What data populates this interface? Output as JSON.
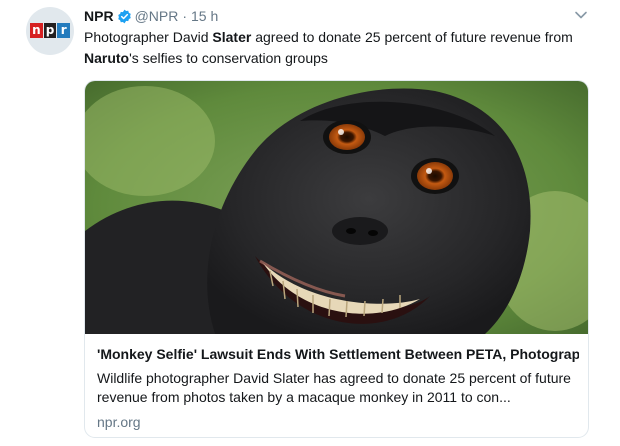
{
  "tweet": {
    "author_name": "NPR",
    "handle": "@NPR",
    "separator": "·",
    "time": "15 h",
    "logo_letters": [
      "n",
      "p",
      "r"
    ],
    "text_parts": [
      "Photographer David ",
      "Slater",
      " agreed to donate 25 percent of future revenue from ",
      "Naruto",
      "'s selfies to conservation groups"
    ],
    "card": {
      "title": "'Monkey Selfie' Lawsuit Ends With Settlement Between PETA, Photographer",
      "description": "Wildlife photographer David Slater has agreed to donate 25 percent of future revenue from photos taken by a macaque monkey in 2011 to con...",
      "domain": "npr.org",
      "image_icon": "macaque-selfie-photo"
    }
  },
  "colors": {
    "npr_red": "#d62021",
    "npr_black": "#231f20",
    "npr_blue": "#237bbd",
    "verified_blue": "#1da1f2",
    "muted": "#657786",
    "text": "#14171a"
  },
  "icons": {
    "verified": "verified-badge-icon",
    "menu": "chevron-down-icon"
  }
}
